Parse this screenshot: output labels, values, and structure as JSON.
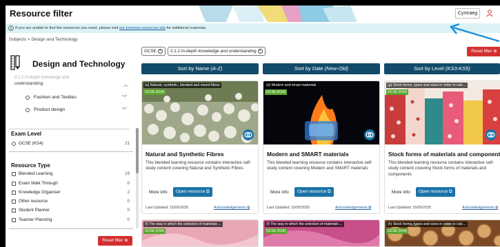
{
  "header": {
    "title": "Resource filter",
    "language_button": "Cymraeg",
    "user_icon": "user-icon"
  },
  "info_bar": {
    "text_before": "If you are unable to find the resources you need, please visit ",
    "link": "our previous resources site",
    "text_after": " for additional materials."
  },
  "breadcrumb": "Subjects > Design and Technology",
  "sidebar": {
    "subject_title": "Design and Technology",
    "faded_row": "2.1.2 In-depth knowledge and",
    "sub_row": "understanding",
    "options": [
      {
        "label": "Fashion and Textiles"
      },
      {
        "label": "Product design"
      }
    ],
    "exam_level": {
      "title": "Exam Level",
      "items": [
        {
          "label": "GCSE (KS4)",
          "count": "21"
        }
      ]
    },
    "resource_type": {
      "title": "Resource Type",
      "items": [
        {
          "label": "Blended Learning",
          "count": "19"
        },
        {
          "label": "Exam Walk Through",
          "count": "0"
        },
        {
          "label": "Knowledge Organiser",
          "count": "2"
        },
        {
          "label": "Other resource",
          "count": "0"
        },
        {
          "label": "Student Planner",
          "count": "0"
        },
        {
          "label": "Teacher Planning",
          "count": "0"
        }
      ]
    },
    "reset_label": "Reset filter"
  },
  "chips": [
    {
      "label": "GCSE"
    },
    {
      "label": "2.1.2 In-depth knowledge and understanding"
    }
  ],
  "reset_top_label": "Reset filter",
  "sort": [
    {
      "prefix": "Sort by Name ",
      "mode": "(A-Z)"
    },
    {
      "prefix": "Sort by Date ",
      "mode": "(New-Old)"
    },
    {
      "prefix": "Sort by Level ",
      "mode": "(KS3-KS5)"
    }
  ],
  "cards": [
    {
      "caption": "(a) Natural, synthetic, blended and mixed fibres",
      "badge": "GCSE (KS4)",
      "title": "Natural and Synthetic Fibres",
      "desc": "This blended learning resource contains interactive self-study content covering Natural and Synthetic Fibres",
      "more": "More info",
      "open": "Open resource",
      "date": "Last Updated: 15/05/2025",
      "ack": "Acknowledgements",
      "image_colors": [
        "#5a6e3c",
        "#e9e6dc",
        "#9fa88a"
      ]
    },
    {
      "caption": "(e) Modern and smart materials",
      "badge": "GCSE (KS4)",
      "title": "Modern and SMART materials",
      "desc": "This blended learning resource contains interactive self-study content covering Modern and SMART materials",
      "more": "More info",
      "open": "Open resource",
      "date": "Last Updated: 15/05/2025",
      "ack": "Acknowledgements",
      "image_colors": [
        "#05060c",
        "#ff7a1a",
        "#2b7bd8"
      ]
    },
    {
      "caption": "(g) Stock forms, types and sizes in order to calc...",
      "badge": "GCSE (KS4)",
      "title": "Stock forms of materials and components",
      "desc": "This blended learning resource contains interactive self-study content covering Stock forms of materials and components",
      "more": "More info",
      "open": "Open resource",
      "date": "Last Updated: 15/05/2025",
      "ack": "Acknowledgements",
      "image_colors": [
        "#c83c3c",
        "#f4e9e0",
        "#2f8a8a"
      ]
    }
  ],
  "cards_row2": [
    {
      "caption": "(f) The way in which the selection of materials ...",
      "badge": "GCSE (KS4)",
      "image_color": "#e9a6b4"
    },
    {
      "caption": "(f) The way in which the selection of materials ...",
      "badge": "GCSE (KS4)",
      "image_color": "#c94f8a"
    },
    {
      "caption": "(h) Stock forms, types and sizes in order to calc...",
      "badge": "GCSE (KS4)",
      "image_color": "#a4683a"
    }
  ],
  "colors": {
    "brand_blue": "#134b6b",
    "button_blue": "#1a73a8",
    "reset_red": "#d32f2f",
    "badge_green": "#5aa52f",
    "info_bg": "#dcf2f6",
    "arrow": "#1a8fd8"
  }
}
